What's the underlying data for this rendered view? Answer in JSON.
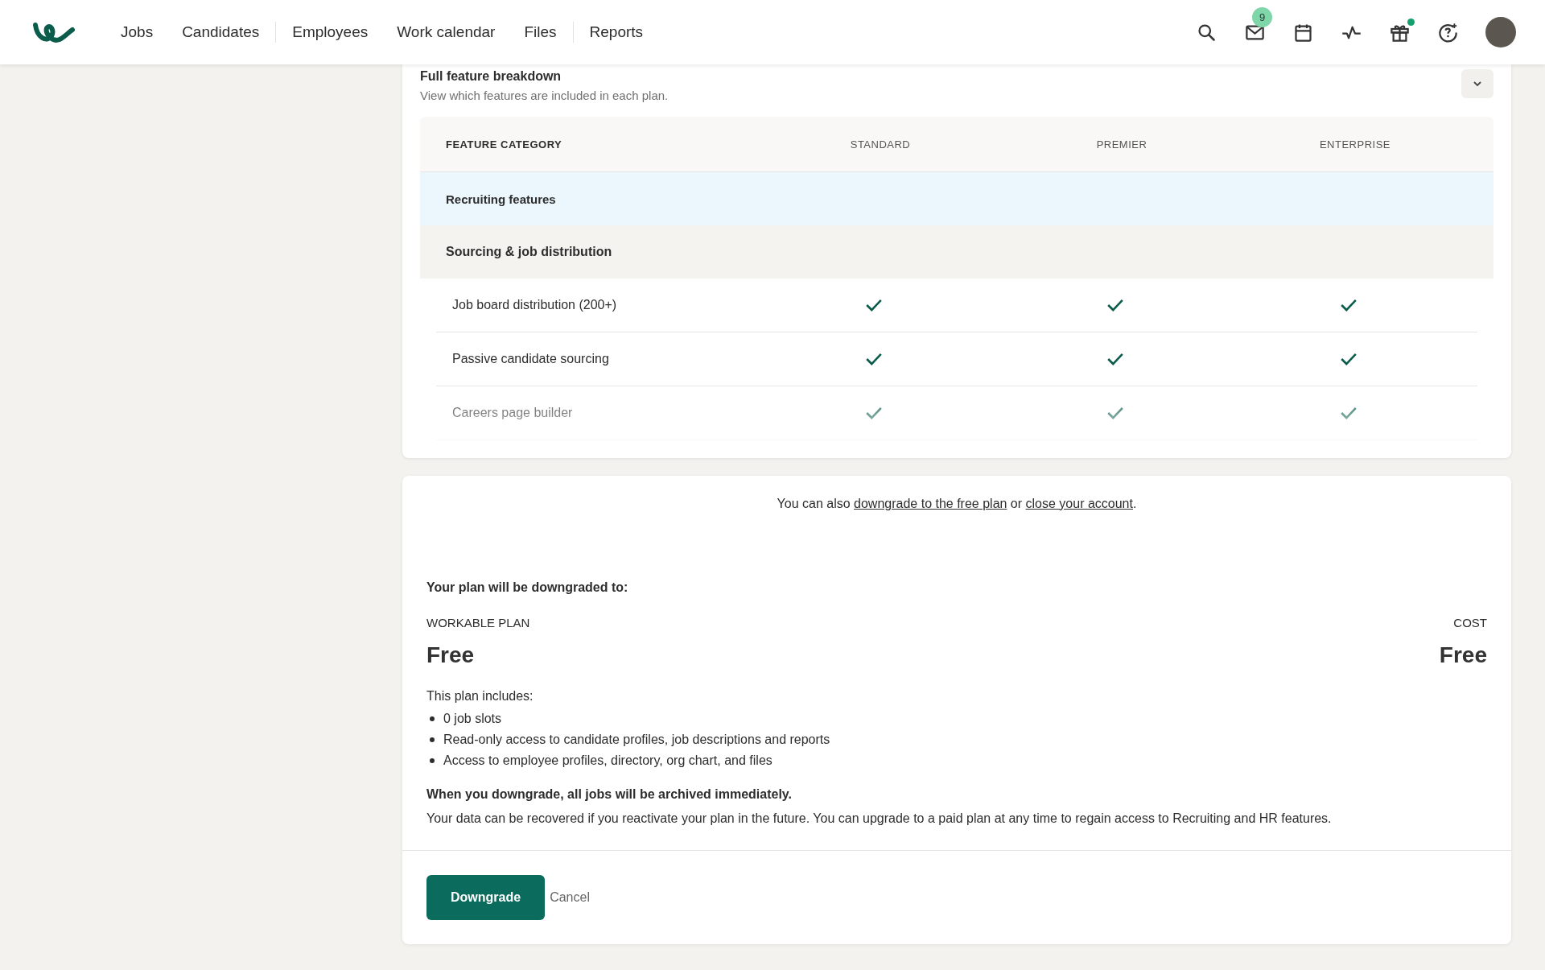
{
  "nav": {
    "items": [
      {
        "label": "Jobs",
        "divider_after": false
      },
      {
        "label": "Candidates",
        "divider_after": true
      },
      {
        "label": "Employees",
        "divider_after": false
      },
      {
        "label": "Work calendar",
        "divider_after": false
      },
      {
        "label": "Files",
        "divider_after": true
      },
      {
        "label": "Reports",
        "divider_after": false
      }
    ],
    "mail_badge": "9",
    "gift_dot": true
  },
  "breakdown": {
    "title": "Full feature breakdown",
    "subtitle": "View which features are included in each plan.",
    "expanded": true,
    "columns": [
      "FEATURE CATEGORY",
      "STANDARD",
      "PREMIER",
      "ENTERPRISE"
    ],
    "rows": [
      {
        "kind": "category",
        "label": "Recruiting features"
      },
      {
        "kind": "group",
        "label": "Sourcing & job distribution"
      },
      {
        "kind": "feature",
        "label": "Job board distribution (200+)",
        "included": [
          true,
          true,
          true
        ]
      },
      {
        "kind": "feature",
        "label": "Passive candidate sourcing",
        "included": [
          true,
          true,
          true
        ]
      },
      {
        "kind": "feature",
        "label": "Careers page builder",
        "included": [
          true,
          true,
          true
        ]
      }
    ]
  },
  "downgrade": {
    "alt_prefix": "You can also",
    "alt_link_1": "downgrade to the free plan",
    "alt_middle": "or",
    "alt_link_2": "close your account",
    "alt_suffix": ".",
    "heading": "Your plan will be downgraded to:",
    "plan_label": "WORKABLE PLAN",
    "plan_name": "Free",
    "cost_label": "COST",
    "cost_value": "Free",
    "includes_title": "This plan includes:",
    "includes": [
      "0 job slots",
      "Read-only access to candidate profiles, job descriptions and reports",
      "Access to employee profiles, directory, org chart, and files"
    ],
    "warning": "When you downgrade, all jobs will be archived immediately.",
    "note": "Your data can be recovered if you reactivate your plan in the future. You can upgrade to a paid plan at any time to regain access to Recruiting and HR features.",
    "buttons": [
      {
        "kind": "primary",
        "label": "Downgrade"
      },
      {
        "kind": "link",
        "label": "Cancel"
      }
    ]
  }
}
